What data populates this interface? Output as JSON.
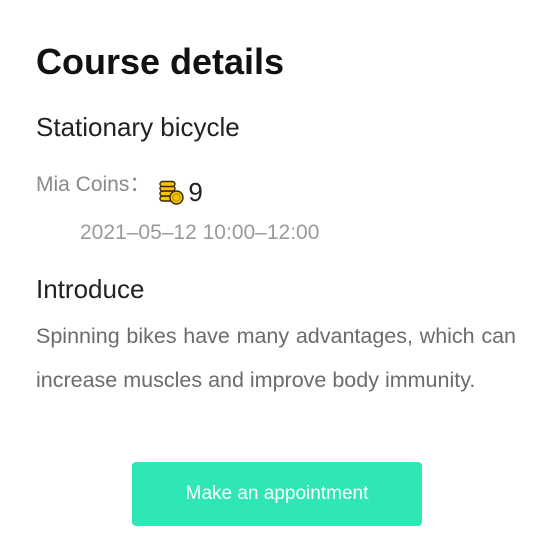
{
  "page": {
    "title": "Course details"
  },
  "course": {
    "name": "Stationary bicycle",
    "coins_label": "Mia Coins：",
    "coins_icon": "stacked-gold-coins-icon",
    "coins_value": "9",
    "schedule": "2021–05–12 10:00–12:00"
  },
  "intro": {
    "heading": "Introduce",
    "text": "Spinning bikes have many advantages, which can increase muscles and improve body immunity."
  },
  "actions": {
    "appointment_label": "Make an appointment"
  },
  "colors": {
    "accent": "#2ee6b6",
    "coin_gold": "#f5c400",
    "coin_outline": "#3a2a00",
    "muted_text": "#8a8a8a"
  }
}
